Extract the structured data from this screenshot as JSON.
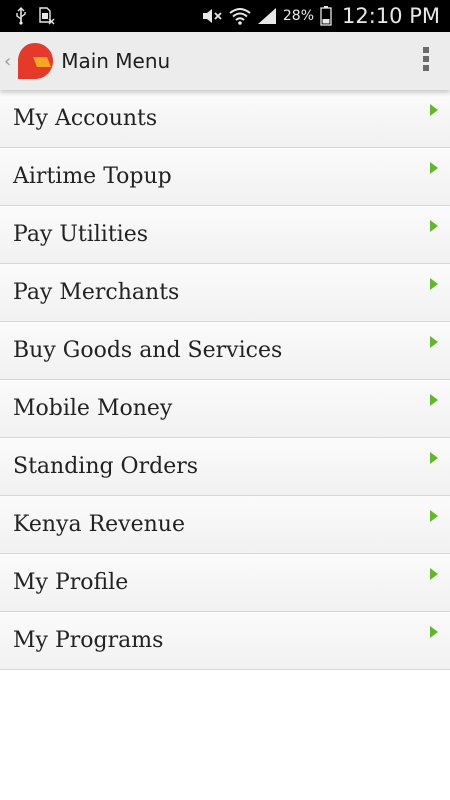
{
  "status_bar": {
    "icons_left": [
      "usb-icon",
      "sim-card-icon"
    ],
    "icons_right": [
      "mute-icon",
      "wifi-icon",
      "signal-icon",
      "battery-icon"
    ],
    "battery_percent": "28%",
    "time": "12:10 PM"
  },
  "action_bar": {
    "title": "Main Menu",
    "back_icon": "chevron-left-icon",
    "logo_icon": "app-logo-icon",
    "overflow_icon": "overflow-menu-icon"
  },
  "menu": {
    "items": [
      {
        "label": "My Accounts"
      },
      {
        "label": "Airtime Topup"
      },
      {
        "label": "Pay Utilities"
      },
      {
        "label": "Pay Merchants"
      },
      {
        "label": "Buy Goods and Services"
      },
      {
        "label": "Mobile Money"
      },
      {
        "label": "Standing Orders"
      },
      {
        "label": "Kenya Revenue"
      },
      {
        "label": "My Profile"
      },
      {
        "label": "My Programs"
      }
    ],
    "arrow_icon": "chevron-right-icon",
    "arrow_color": "#62b82a"
  },
  "colors": {
    "status_bar_bg": "#000000",
    "action_bar_bg": "#ececec",
    "logo_red": "#e53a2a",
    "logo_orange": "#f5a623"
  }
}
